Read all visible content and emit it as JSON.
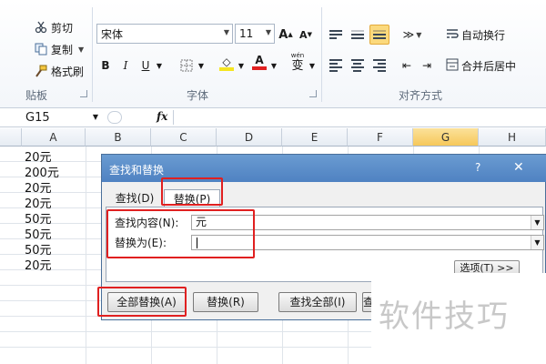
{
  "clipboard": {
    "cut": "剪切",
    "copy": "复制",
    "format_painter": "格式刷",
    "group_label": "贴板"
  },
  "font": {
    "family": "宋体",
    "size": "11",
    "grow_label": "A",
    "shrink_label": "A",
    "bold": "B",
    "italic": "I",
    "underline": "U",
    "font_color_label": "A",
    "phonetic_label": "wén",
    "phonetic_char": "变",
    "group_label": "字体"
  },
  "alignment": {
    "wrap_text": "自动换行",
    "merge_center": "合并后居中",
    "group_label": "对齐方式"
  },
  "formula_bar": {
    "name_box": "G15",
    "fx": "fx"
  },
  "columns": [
    "A",
    "B",
    "C",
    "D",
    "E",
    "F",
    "G",
    "H"
  ],
  "cells_a": [
    "20元",
    "200元",
    "20元",
    "20元",
    "50元",
    "50元",
    "50元",
    "20元"
  ],
  "dialog": {
    "title": "查找和替换",
    "help": "?",
    "close": "✕",
    "tab_find": "查找(D)",
    "tab_replace": "替换(P)",
    "find_label": "查找内容(N):",
    "find_value": "元",
    "replace_label": "替换为(E):",
    "replace_value": "",
    "options_button": "选项(T) >>",
    "replace_all_button": "全部替换(A)",
    "replace_button": "替换(R)",
    "find_all_button": "查找全部(I)",
    "find_next_button": "查"
  },
  "watermark": "软件技巧",
  "colors": {
    "highlight_frame": "#e02020",
    "title_bar": "#5b8dc9",
    "selected_column": "#f6c85a",
    "font_color_bar": "#e02020",
    "fill_color_bar": "#f5e51f"
  }
}
